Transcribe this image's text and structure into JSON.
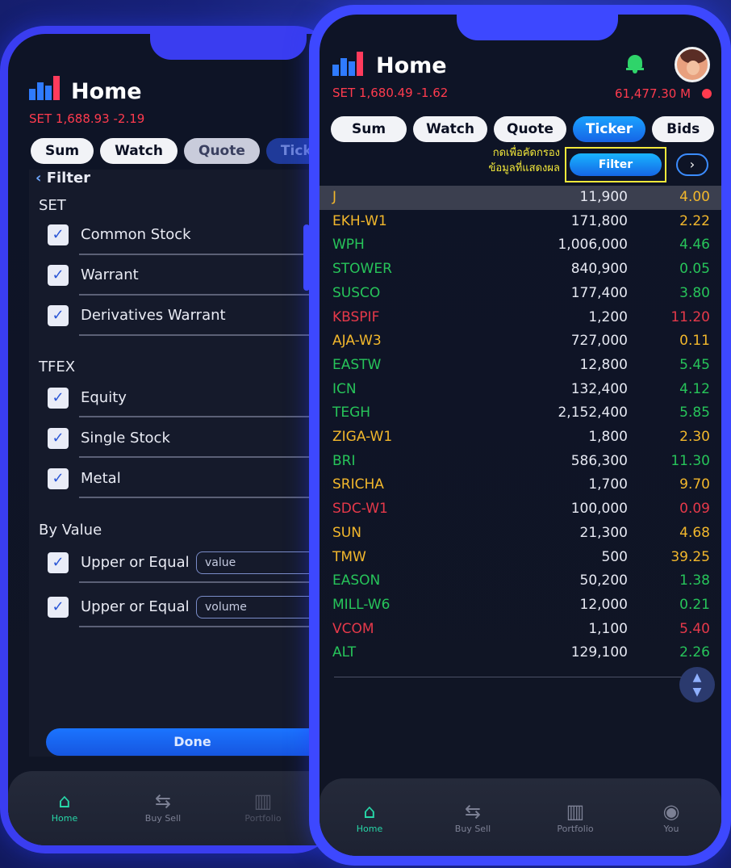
{
  "left": {
    "title": "Home",
    "set_index": "SET 1,688.93 -2.19",
    "tabs": [
      "Sum",
      "Watch",
      "Quote",
      "Ticke"
    ],
    "filter_back": "Filter",
    "sections": {
      "set": "SET",
      "tfex": "TFEX",
      "by_value": "By Value"
    },
    "set_items": [
      "Common Stock",
      "Warrant",
      "Derivatives Warrant"
    ],
    "tfex_items": [
      "Equity",
      "Single Stock",
      "Metal"
    ],
    "by_value_items": [
      {
        "label": "Upper or Equal",
        "placeholder": "value"
      },
      {
        "label": "Upper or Equal",
        "placeholder": "volume"
      }
    ],
    "done_label": "Done",
    "nav": [
      "Home",
      "Buy Sell",
      "Portfolio"
    ]
  },
  "right": {
    "title": "Home",
    "set_index": "SET 1,680.49 -1.62",
    "market_value": "61,477.30 M",
    "tabs": [
      "Sum",
      "Watch",
      "Quote",
      "Ticker",
      "Bids"
    ],
    "annotation_line1": "กดเพื่อคัดกรอง",
    "annotation_line2": "ข้อมูลที่แสดงผล",
    "filter_label": "Filter",
    "nav": [
      "Home",
      "Buy Sell",
      "Portfolio",
      "You"
    ],
    "rows": [
      {
        "symbol": "J",
        "volume": "11,900",
        "value": "4.00",
        "color": "#f2b72c"
      },
      {
        "symbol": "EKH-W1",
        "volume": "171,800",
        "value": "2.22",
        "color": "#f2b72c"
      },
      {
        "symbol": "WPH",
        "volume": "1,006,000",
        "value": "4.46",
        "color": "#27c45a"
      },
      {
        "symbol": "STOWER",
        "volume": "840,900",
        "value": "0.05",
        "color": "#27c45a"
      },
      {
        "symbol": "SUSCO",
        "volume": "177,400",
        "value": "3.80",
        "color": "#27c45a"
      },
      {
        "symbol": "KBSPIF",
        "volume": "1,200",
        "value": "11.20",
        "color": "#e6394a"
      },
      {
        "symbol": "AJA-W3",
        "volume": "727,000",
        "value": "0.11",
        "color": "#f2b72c"
      },
      {
        "symbol": "EASTW",
        "volume": "12,800",
        "value": "5.45",
        "color": "#27c45a"
      },
      {
        "symbol": "ICN",
        "volume": "132,400",
        "value": "4.12",
        "color": "#27c45a"
      },
      {
        "symbol": "TEGH",
        "volume": "2,152,400",
        "value": "5.85",
        "color": "#27c45a"
      },
      {
        "symbol": "ZIGA-W1",
        "volume": "1,800",
        "value": "2.30",
        "color": "#f2b72c"
      },
      {
        "symbol": "BRI",
        "volume": "586,300",
        "value": "11.30",
        "color": "#27c45a"
      },
      {
        "symbol": "SRICHA",
        "volume": "1,700",
        "value": "9.70",
        "color": "#f2b72c"
      },
      {
        "symbol": "SDC-W1",
        "volume": "100,000",
        "value": "0.09",
        "color": "#e6394a"
      },
      {
        "symbol": "SUN",
        "volume": "21,300",
        "value": "4.68",
        "color": "#f2b72c"
      },
      {
        "symbol": "TMW",
        "volume": "500",
        "value": "39.25",
        "color": "#f2b72c"
      },
      {
        "symbol": "EASON",
        "volume": "50,200",
        "value": "1.38",
        "color": "#27c45a"
      },
      {
        "symbol": "MILL-W6",
        "volume": "12,000",
        "value": "0.21",
        "color": "#27c45a"
      },
      {
        "symbol": "VCOM",
        "volume": "1,100",
        "value": "5.40",
        "color": "#e6394a"
      },
      {
        "symbol": "ALT",
        "volume": "129,100",
        "value": "2.26",
        "color": "#27c45a"
      }
    ]
  }
}
